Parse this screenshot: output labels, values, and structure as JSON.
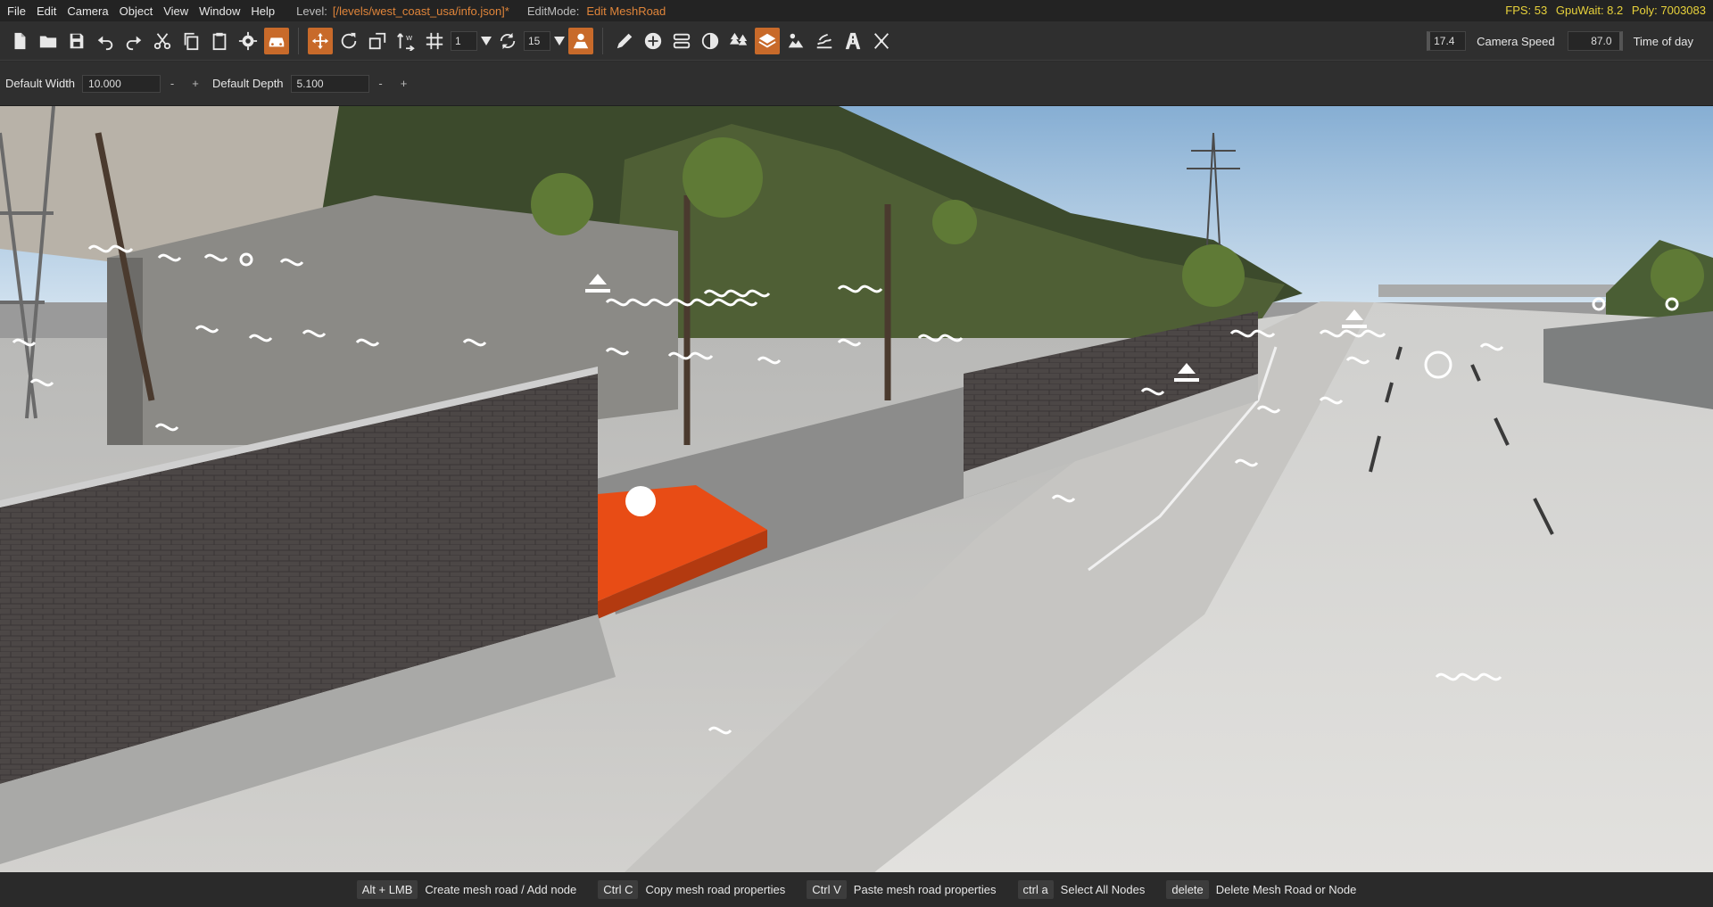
{
  "menu": [
    "File",
    "Edit",
    "Camera",
    "Object",
    "View",
    "Window",
    "Help"
  ],
  "level": {
    "label": "Level:",
    "path": "[/levels/west_coast_usa/info.json]*"
  },
  "edit_mode": {
    "label": "EditMode:",
    "value": "Edit MeshRoad"
  },
  "perf": {
    "fps": "FPS: 53",
    "gpu": "GpuWait: 8.2",
    "poly": "Poly: 7003083"
  },
  "toolbar": {
    "snap_value": "1",
    "rotate_value": "15",
    "camera_speed_value": "17.4",
    "camera_speed_label": "Camera Speed",
    "time_of_day_value": "87.0",
    "time_of_day_label": "Time of day"
  },
  "subbar": {
    "width_label": "Default Width",
    "width_value": "10.000",
    "depth_label": "Default Depth",
    "depth_value": "5.100",
    "minus": "-",
    "plus": "+"
  },
  "hints": [
    {
      "key": "Alt + LMB",
      "text": "Create mesh road / Add node"
    },
    {
      "key": "Ctrl C",
      "text": "Copy mesh road properties"
    },
    {
      "key": "Ctrl V",
      "text": "Paste mesh road properties"
    },
    {
      "key": "ctrl a",
      "text": "Select All Nodes"
    },
    {
      "key": "delete",
      "text": "Delete Mesh Road or Node"
    }
  ],
  "colors": {
    "accent": "#c86a2a",
    "perf": "#e8d23b",
    "level_path": "#e0853a",
    "road_orange": "#e84c15"
  },
  "icons": [
    "new-file-icon",
    "open-folder-icon",
    "save-icon",
    "undo-icon",
    "redo-icon",
    "cut-icon",
    "copy-icon",
    "paste-icon",
    "settings-icon",
    "vehicle-icon",
    "move-gizmo-icon",
    "rotate-gizmo-icon",
    "scale-gizmo-icon",
    "align-icon",
    "grid-snap-icon",
    "rotate-snap-icon",
    "terrain-icon",
    "pencil-icon",
    "add-node-icon",
    "road-icon",
    "decal-icon",
    "forest-icon",
    "meshroad-icon",
    "river-icon",
    "waves-icon",
    "road-markings-icon",
    "transform-icon"
  ]
}
